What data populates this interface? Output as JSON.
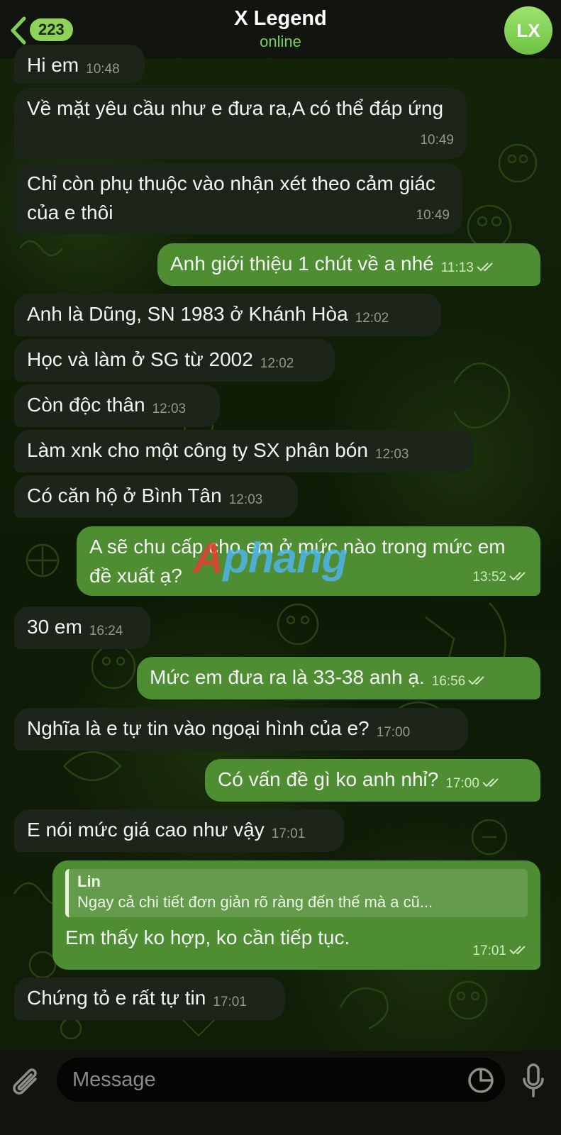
{
  "header": {
    "unread_count": "223",
    "title": "X Legend",
    "status": "online",
    "avatar_initials": "LX"
  },
  "messages": [
    {
      "dir": "in",
      "text": "Hi em",
      "time": "10:48"
    },
    {
      "dir": "in",
      "text": "Về mặt yêu cầu như e đưa ra,A có thể đáp ứng",
      "time": "10:49"
    },
    {
      "dir": "in",
      "text": "Chỉ còn phụ thuộc vào nhận xét theo cảm giác của e thôi",
      "time": "10:49"
    },
    {
      "dir": "out",
      "text": "Anh giới thiệu 1 chút về a nhé",
      "time": "11:13",
      "read": true
    },
    {
      "dir": "in",
      "text": "Anh là Dũng, SN 1983 ở Khánh Hòa",
      "time": "12:02"
    },
    {
      "dir": "in",
      "text": "Học và làm ở SG từ 2002",
      "time": "12:02"
    },
    {
      "dir": "in",
      "text": "Còn độc thân",
      "time": "12:03"
    },
    {
      "dir": "in",
      "text": "Làm xnk cho một công ty SX phân bón",
      "time": "12:03"
    },
    {
      "dir": "in",
      "text": "Có căn hộ ở Bình Tân",
      "time": "12:03"
    },
    {
      "dir": "in",
      "text": "A sẽ chu cấp cho em ở mức nào trong mức em đề xuất ạ?",
      "time": "13:52",
      "read": true
    },
    {
      "dir": "in",
      "text": "30 em",
      "time": "16:24"
    },
    {
      "dir": "out",
      "text": "Mức em đưa ra là 33-38 anh ạ.",
      "time": "16:56",
      "read": true
    },
    {
      "dir": "in",
      "text": "Nghĩa là e tự tin vào ngoại hình của e?",
      "time": "17:00"
    },
    {
      "dir": "out",
      "text": "Có vấn đề gì ko anh nhỉ?",
      "time": "17:00",
      "read": true
    },
    {
      "dir": "in",
      "text": "E nói mức giá cao như vậy",
      "time": "17:01"
    },
    {
      "dir": "out",
      "reply_author": "Lin",
      "reply_preview": "Ngay cả chi tiết đơn giản rõ ràng đến thế mà a cũ...",
      "text": "Em thấy ko hợp, ko cần tiếp tục.",
      "time": "17:01",
      "read": true
    },
    {
      "dir": "in",
      "text": "Chứng tỏ e rất tự tin",
      "time": "17:01"
    }
  ],
  "watermark": {
    "part1": "A",
    "part2": "phang"
  },
  "composer": {
    "placeholder": "Message"
  },
  "icons": {
    "back": "chevron-left-icon",
    "attach": "paperclip-icon",
    "sticker": "sticker-icon",
    "mic": "microphone-icon"
  },
  "colors": {
    "accent": "#7ed05c",
    "outgoing_bubble": "#4e8d32",
    "incoming_bubble": "#1d2419"
  }
}
